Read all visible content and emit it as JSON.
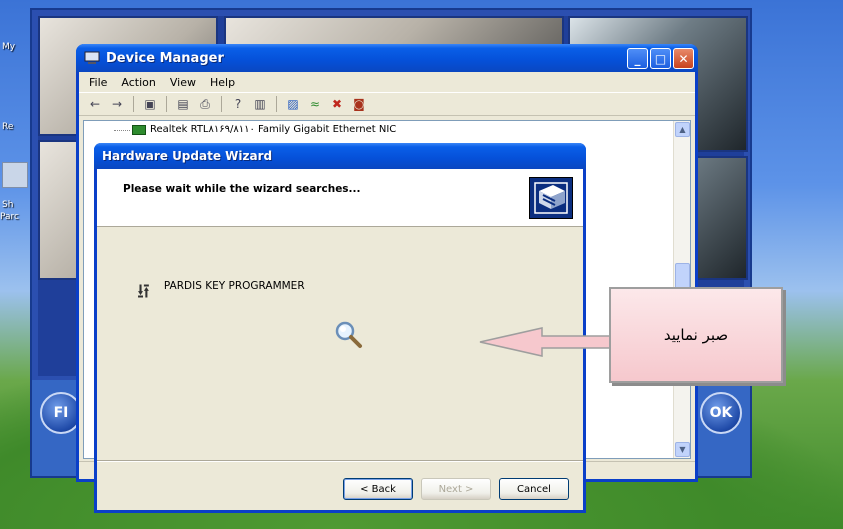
{
  "desktop": {
    "labels": [
      "My",
      "Re",
      "Sh",
      "Parc"
    ]
  },
  "device_manager": {
    "title": "Device Manager",
    "menu": [
      "File",
      "Action",
      "View",
      "Help"
    ],
    "tree_item": "Realtek RTL۸۱۶۹/۸۱۱۰ Family Gigabit Ethernet NIC",
    "controls": {
      "minimize": "_",
      "maximize": "□",
      "close": "✕"
    }
  },
  "wizard": {
    "title": "Hardware Update Wizard",
    "heading": "Please wait while the wizard searches...",
    "device_name": "PARDIS KEY PROGRAMMER",
    "buttons": {
      "back": "< Back",
      "next": "Next >",
      "cancel": "Cancel"
    }
  },
  "callout": {
    "text": "صبر نمایید"
  },
  "viewer": {
    "ok_button": "OK",
    "left_button": "FI"
  },
  "colors": {
    "xp_blue": "#0550d8",
    "callout_fill": "#f6c8cd",
    "dialog_bg": "#ece9d8"
  }
}
